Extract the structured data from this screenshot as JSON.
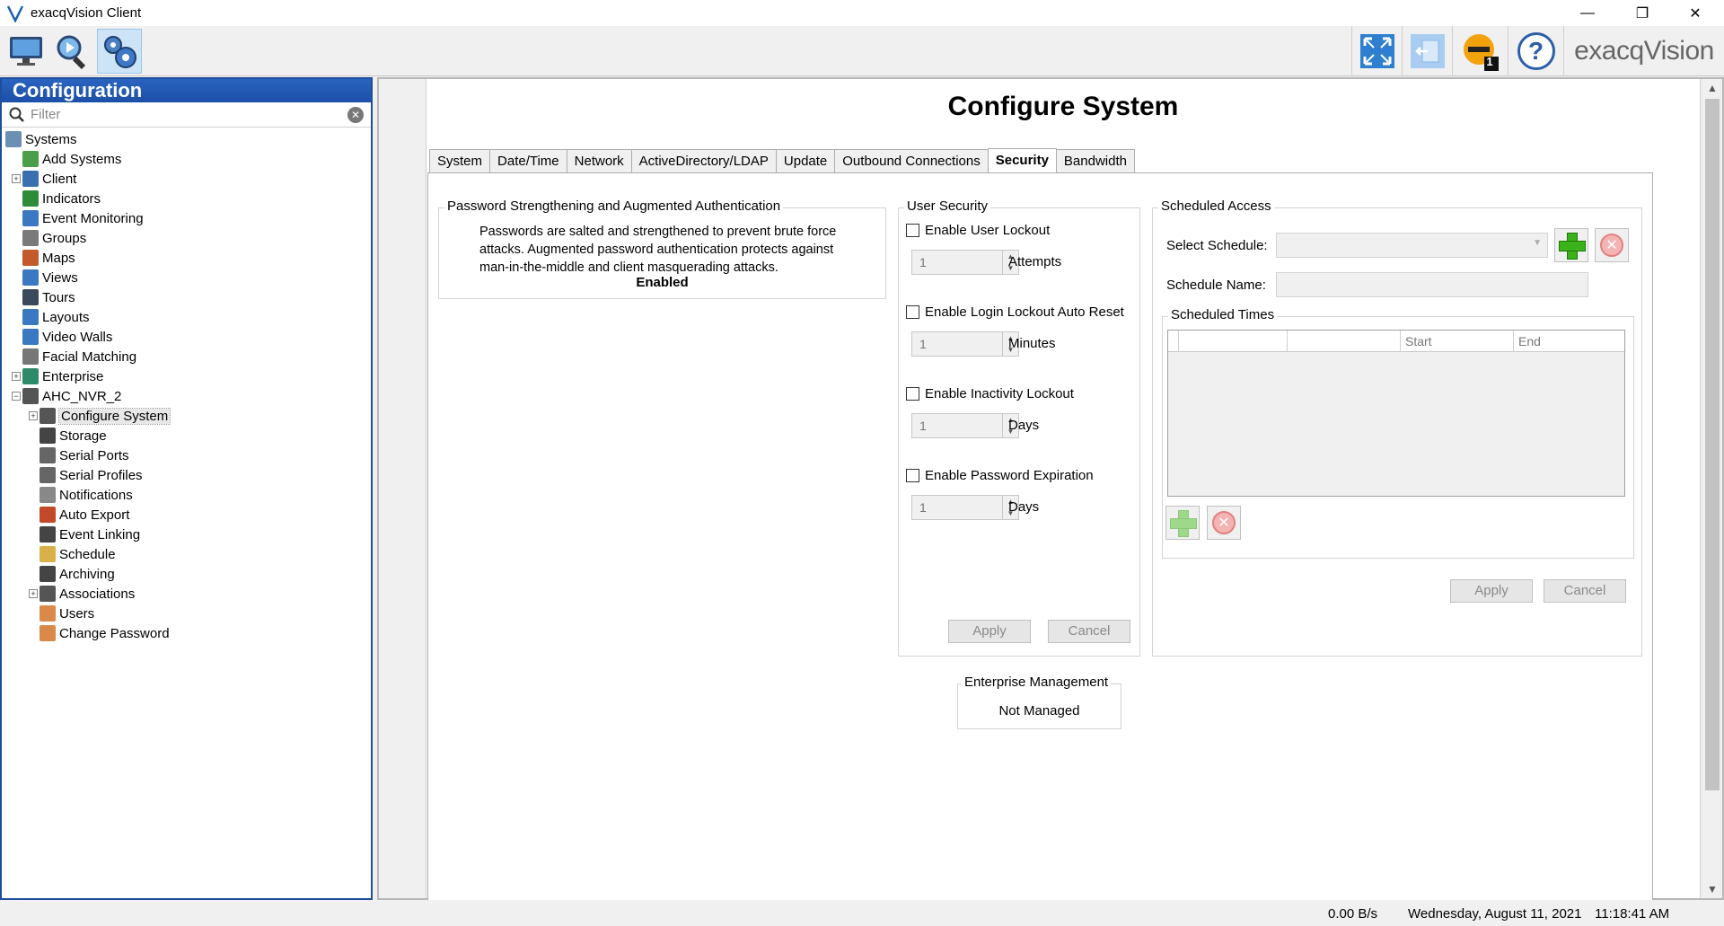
{
  "window": {
    "title": "exacqVision Client",
    "minimize": "—",
    "restore": "❐",
    "close": "✕"
  },
  "toolbar": {
    "brand": "exacqVision",
    "badge_count": "1",
    "help_symbol": "?"
  },
  "sidebar": {
    "header": "Configuration",
    "filter_placeholder": "Filter",
    "items": [
      {
        "label": "Systems",
        "icon": "systems-icon"
      },
      {
        "label": "Add Systems",
        "icon": "add-systems-icon"
      },
      {
        "label": "Client",
        "icon": "client-icon"
      },
      {
        "label": "Indicators",
        "icon": "indicators-icon"
      },
      {
        "label": "Event Monitoring",
        "icon": "event-monitoring-icon"
      },
      {
        "label": "Groups",
        "icon": "groups-icon"
      },
      {
        "label": "Maps",
        "icon": "maps-icon"
      },
      {
        "label": "Views",
        "icon": "views-icon"
      },
      {
        "label": "Tours",
        "icon": "tours-icon"
      },
      {
        "label": "Layouts",
        "icon": "layouts-icon"
      },
      {
        "label": "Video Walls",
        "icon": "video-walls-icon"
      },
      {
        "label": "Facial Matching",
        "icon": "facial-matching-icon"
      },
      {
        "label": "Enterprise",
        "icon": "enterprise-icon"
      },
      {
        "label": "AHC_NVR_2",
        "icon": "server-icon"
      },
      {
        "label": "Configure System",
        "icon": "configure-system-icon"
      },
      {
        "label": "Storage",
        "icon": "storage-icon"
      },
      {
        "label": "Serial Ports",
        "icon": "serial-ports-icon"
      },
      {
        "label": "Serial Profiles",
        "icon": "serial-profiles-icon"
      },
      {
        "label": "Notifications",
        "icon": "notifications-icon"
      },
      {
        "label": "Auto Export",
        "icon": "auto-export-icon"
      },
      {
        "label": "Event Linking",
        "icon": "event-linking-icon"
      },
      {
        "label": "Schedule",
        "icon": "schedule-icon"
      },
      {
        "label": "Archiving",
        "icon": "archiving-icon"
      },
      {
        "label": "Associations",
        "icon": "associations-icon"
      },
      {
        "label": "Users",
        "icon": "users-icon"
      },
      {
        "label": "Change Password",
        "icon": "change-password-icon"
      }
    ]
  },
  "main": {
    "title": "Configure System",
    "tabs": [
      "System",
      "Date/Time",
      "Network",
      "ActiveDirectory/LDAP",
      "Update",
      "Outbound Connections",
      "Security",
      "Bandwidth"
    ],
    "active_tab": "Security",
    "password_group": {
      "title": "Password Strengthening and Augmented Authentication",
      "description_lines": [
        "Passwords are salted and strengthened to prevent brute force",
        "attacks. Augmented password authentication protects against",
        "man-in-the-middle and client masquerading attacks."
      ],
      "status": "Enabled"
    },
    "user_security": {
      "title": "User Security",
      "options": [
        {
          "label": "Enable User Lockout",
          "checked": false,
          "value": "1",
          "unit": "Attempts"
        },
        {
          "label": "Enable Login Lockout Auto Reset",
          "checked": false,
          "value": "1",
          "unit": "Minutes"
        },
        {
          "label": "Enable Inactivity Lockout",
          "checked": false,
          "value": "1",
          "unit": "Days"
        },
        {
          "label": "Enable Password Expiration",
          "checked": false,
          "value": "1",
          "unit": "Days"
        }
      ],
      "apply_label": "Apply",
      "cancel_label": "Cancel"
    },
    "scheduled_access": {
      "title": "Scheduled Access",
      "select_schedule_label": "Select Schedule:",
      "select_schedule_value": "",
      "schedule_name_label": "Schedule Name:",
      "schedule_name_value": "",
      "scheduled_times_title": "Scheduled Times",
      "columns": [
        "",
        "",
        "Start",
        "End"
      ],
      "apply_label": "Apply",
      "cancel_label": "Cancel"
    },
    "enterprise": {
      "title": "Enterprise Management",
      "status": "Not Managed"
    }
  },
  "statusbar": {
    "rate": "0.00 B/s",
    "date": "Wednesday, August 11, 2021",
    "time": "11:18:41 AM"
  }
}
